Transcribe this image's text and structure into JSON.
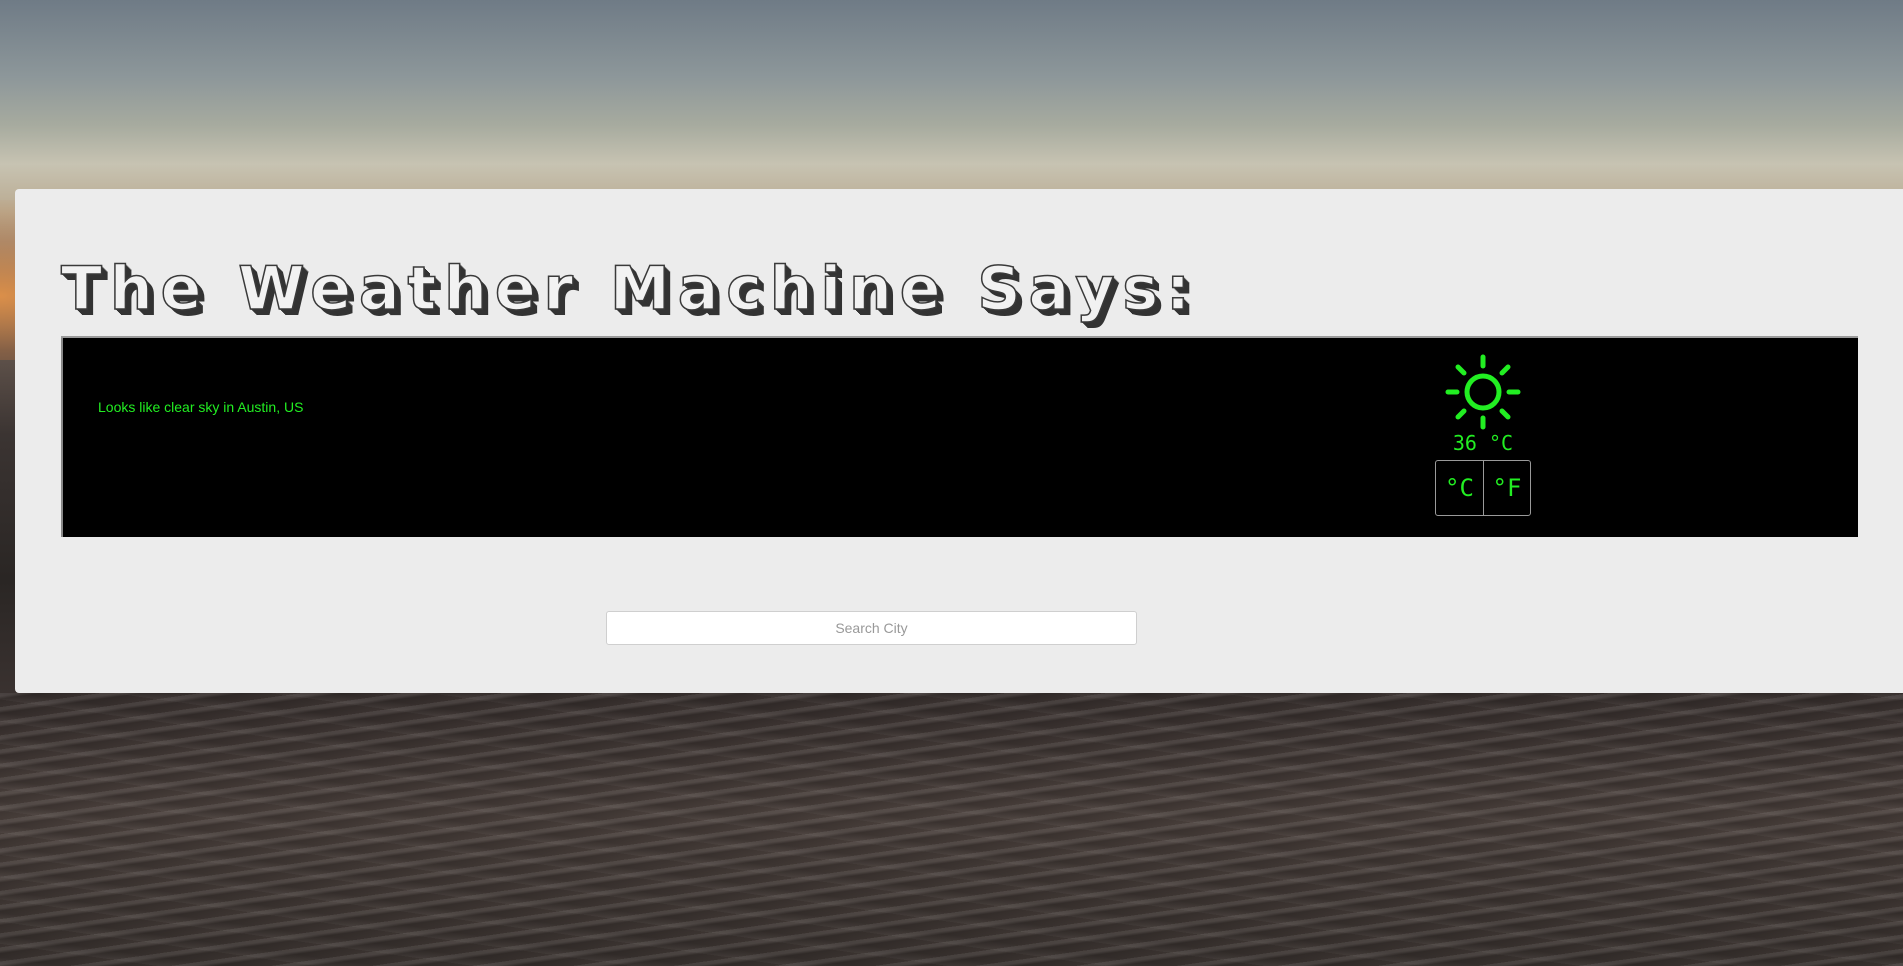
{
  "header": {
    "title": "The Weather Machine Says:"
  },
  "weather": {
    "summary": "Looks like clear sky in Austin, US",
    "icon": "sun-icon",
    "temperature": "36 °C",
    "units": {
      "celsius_label": "°C",
      "fahrenheit_label": "°F"
    }
  },
  "search": {
    "value": "",
    "placeholder": "Search City"
  },
  "colors": {
    "accent": "#22ee22",
    "panel": "#ececec",
    "display": "#000000"
  }
}
